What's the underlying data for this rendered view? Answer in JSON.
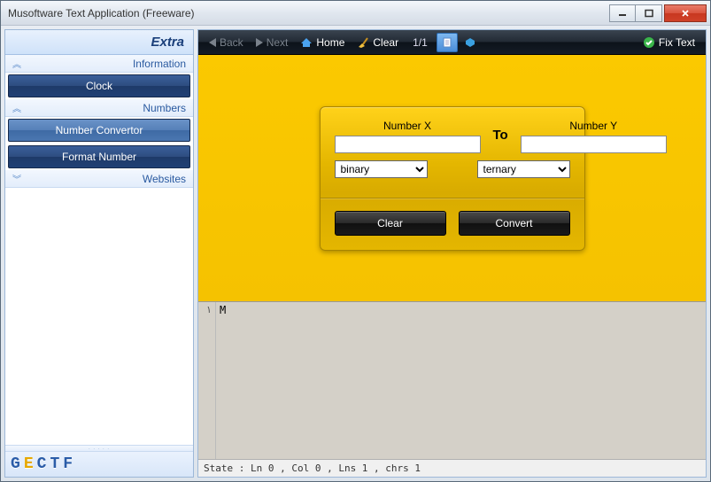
{
  "window": {
    "title": "Musoftware Text Application (Freeware)"
  },
  "sidebar": {
    "header": "Extra",
    "groups": [
      {
        "label": "Information",
        "items": [
          {
            "label": "Clock"
          }
        ]
      },
      {
        "label": "Numbers",
        "items": [
          {
            "label": "Number Convertor",
            "selected": true
          },
          {
            "label": "Format Number"
          }
        ]
      },
      {
        "label": "Websites",
        "items": []
      }
    ],
    "logo_letters": [
      "G",
      "E",
      "C",
      "T",
      "F"
    ]
  },
  "toolbar": {
    "back": "Back",
    "next": "Next",
    "home": "Home",
    "clear": "Clear",
    "page_count": "1/1",
    "fixtext": "Fix Text"
  },
  "converter": {
    "label_x": "Number X",
    "label_y": "Number Y",
    "value_x": "",
    "value_y": "",
    "from_sel": "binary",
    "to_sel": "ternary",
    "to_label": "To",
    "clear_btn": "Clear",
    "convert_btn": "Convert"
  },
  "editor": {
    "line_number": "١",
    "content": "M"
  },
  "statusbar": {
    "text": "State :  Ln 0 , Col 0 , Lns 1  , chrs 1"
  }
}
